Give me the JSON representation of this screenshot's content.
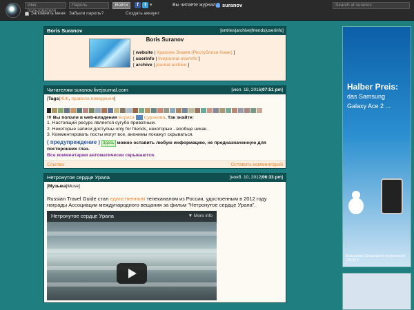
{
  "topbar": {
    "username_placeholder": "Имя пользователя",
    "password_placeholder": "Пароль",
    "login_label": "Войти",
    "remember_label": "Запомнить меня",
    "forgot_label": "Забыли пароль?",
    "create_label": "Создать аккаунт",
    "reading_label": "Вы читаете журнал",
    "reading_user": "suranov",
    "search_placeholder": "Search at suranov",
    "fb_glyph": "f",
    "tw_glyph": "t",
    "more_glyph": "▾"
  },
  "profile": {
    "header_title": "Boris Suranov",
    "nav": "[entries|archive|friends|userinfo]",
    "title": "Boris Suranov",
    "rows": [
      {
        "key": "website",
        "value": "Красное Знамя (Республика Коми)"
      },
      {
        "key": "userinfo",
        "value": "livejournal userinfo"
      },
      {
        "key": "archive",
        "value": "journal archive"
      }
    ]
  },
  "entry1": {
    "title": "Читателям suranov.livejournal.com",
    "date": "[июл. 18, 2016|",
    "time": "07:51 pm",
    "tags_label": "Tags",
    "tag1": "ЖЖ",
    "tag2": "правила поведения",
    "intro_a": "!!!",
    "intro_b": "Вы попали в web-владения",
    "name1": "Бориса",
    "name2": "Суранова",
    "intro_c": ". Так знайте:",
    "lines": [
      "1. Настоящий ресурс является сугубо приватным.",
      "2. Некоторые записи доступны only for friends, некоторые - вообще никак.",
      "3. Комментировать посты могут все, анонимы покажут скрываться."
    ],
    "warn": "( предупреждение )",
    "here": "Здесь",
    "warn_text": "можно оставить любую информацию, не предназначенную для посторонних глаз.",
    "footer_note": "Все комментарии автоматически скрываются.",
    "link_left": "Ссылка",
    "link_right": "Оставить комментарий"
  },
  "entry2": {
    "title": "Нетронутое сердце Урала",
    "date": "[нояб. 10, 2012|",
    "time": "06:33 pm",
    "tag_bold": "Музыка",
    "tag_plain": "Muse",
    "text_a": "Russian Travel Guide стал",
    "text_link": "единственным",
    "text_b": "телеканалом из России, удостоенным в 2012 году награды Ассоциации международного вещания за фильм \"Нетронутое сердце Урала\".",
    "video_title": "Нетронутое сердце Урала",
    "video_more": "More info"
  },
  "ad": {
    "line1": "Halber Preis:",
    "line2": "das Samsung",
    "line3": "Galaxy Ace 2 ...",
    "fine": "Reduzierter Gesamtpreis (rechnerisch) 139,50 €"
  },
  "colors": {
    "teal": "#1f7f80",
    "header": "#0f4f50",
    "link": "#f08a3c"
  }
}
